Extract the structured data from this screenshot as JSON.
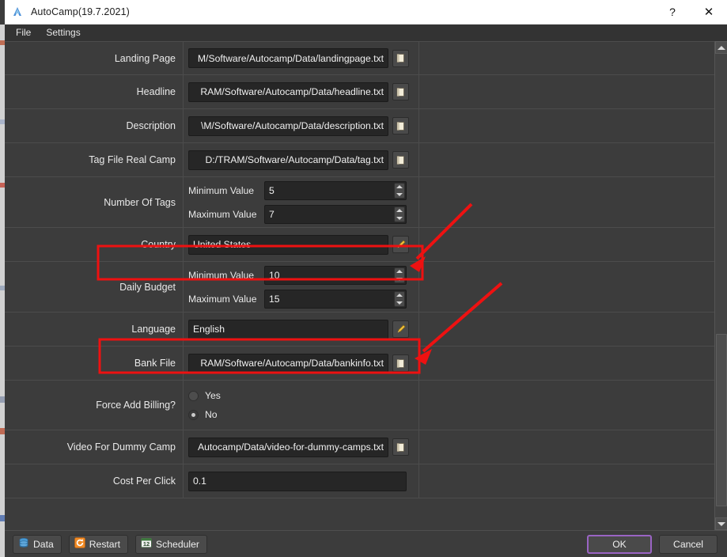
{
  "window": {
    "title": "AutoCamp(19.7.2021)",
    "app_icon": "autocamp-logo-icon",
    "help_label": "?",
    "close_label": "✕"
  },
  "menubar": {
    "items": [
      {
        "label": "File"
      },
      {
        "label": "Settings"
      }
    ]
  },
  "form": {
    "rows": [
      {
        "label": "Landing Page",
        "type": "file",
        "value": "M/Software/Autocamp/Data/landingpage.txt",
        "browse_icon": "folder-icon"
      },
      {
        "label": "Headline",
        "type": "file",
        "value": "RAM/Software/Autocamp/Data/headline.txt",
        "browse_icon": "folder-icon"
      },
      {
        "label": "Description",
        "type": "file",
        "value": "\\M/Software/Autocamp/Data/description.txt",
        "browse_icon": "folder-icon"
      },
      {
        "label": "Tag File Real Camp",
        "type": "file",
        "value": "D:/TRAM/Software/Autocamp/Data/tag.txt",
        "browse_icon": "folder-icon"
      },
      {
        "label": "Number Of Tags",
        "type": "minmax",
        "min_label": "Minimum Value",
        "min_value": "5",
        "max_label": "Maximum Value",
        "max_value": "7"
      },
      {
        "label": "Country",
        "type": "edit",
        "value": "United States",
        "edit_icon": "pencil-icon",
        "highlighted": true
      },
      {
        "label": "Daily Budget",
        "type": "minmax",
        "min_label": "Minimum Value",
        "min_value": "10",
        "max_label": "Maximum Value",
        "max_value": "15"
      },
      {
        "label": "Language",
        "type": "edit",
        "value": "English",
        "edit_icon": "pencil-icon",
        "highlighted": true
      },
      {
        "label": "Bank File",
        "type": "file",
        "value": "RAM/Software/Autocamp/Data/bankinfo.txt",
        "browse_icon": "folder-icon"
      },
      {
        "label": "Force Add Billing?",
        "type": "radio",
        "options": [
          {
            "label": "Yes",
            "checked": false
          },
          {
            "label": "No",
            "checked": true
          }
        ]
      },
      {
        "label": "Video For Dummy Camp",
        "type": "file",
        "value": "Autocamp/Data/video-for-dummy-camps.txt",
        "browse_icon": "folder-icon"
      },
      {
        "label": "Cost Per Click",
        "type": "text",
        "value": "0.1"
      }
    ]
  },
  "footer": {
    "data_label": "Data",
    "data_icon": "database-icon",
    "restart_label": "Restart",
    "restart_icon": "refresh-icon",
    "scheduler_label": "Scheduler",
    "scheduler_icon": "calendar-12-icon",
    "ok_label": "OK",
    "cancel_label": "Cancel"
  },
  "scrollbar": {
    "up_icon": "chevron-up-icon",
    "down_icon": "chevron-down-icon"
  },
  "colors": {
    "window_bg": "#3c3c3c",
    "input_bg": "#262626",
    "accent_focus": "#9a64c4",
    "annotation": "#ee1111",
    "pencil": "#f0b429",
    "restart": "#f08a24"
  }
}
